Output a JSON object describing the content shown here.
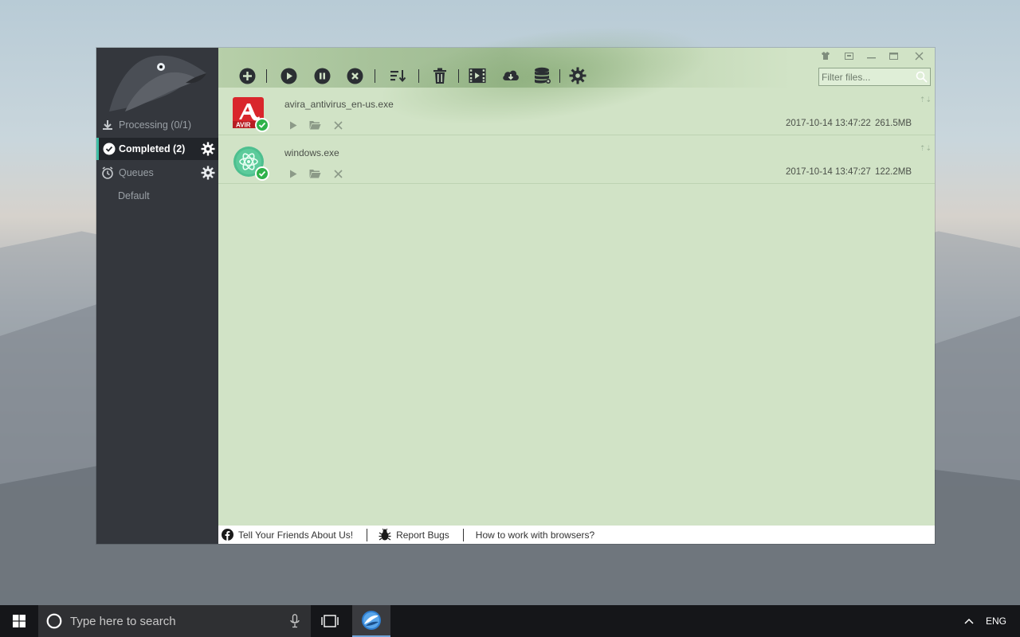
{
  "desktop": {
    "wallpaper": "mountain-mist"
  },
  "window": {
    "controls": [
      "skin-icon",
      "mini-mode-icon",
      "minimize-icon",
      "maximize-icon",
      "close-icon"
    ]
  },
  "sidebar": {
    "processing": "Processing (0/1)",
    "completed": "Completed (2)",
    "queues": "Queues",
    "default_queue": "Default"
  },
  "toolbar": {
    "buttons": [
      "add-icon",
      "start-icon",
      "pause-icon",
      "stop-icon",
      "sort-icon",
      "delete-icon",
      "video-icon",
      "cloud-download-icon",
      "database-icon",
      "settings-icon"
    ],
    "filter_placeholder": "Filter files..."
  },
  "downloads": [
    {
      "name": "avira_antivirus_en-us.exe",
      "date": "2017-10-14 13:47:22",
      "size": "261.5MB",
      "icon": "avira-icon",
      "status": "completed"
    },
    {
      "name": "windows.exe",
      "date": "2017-10-14 13:47:27",
      "size": "122.2MB",
      "icon": "atom-icon",
      "status": "completed"
    }
  ],
  "footer": {
    "tell_friends": "Tell Your Friends About Us!",
    "report_bugs": "Report Bugs",
    "how_to": "How to work with browsers?"
  },
  "taskbar": {
    "search_placeholder": "Type here to search",
    "language": "ENG"
  },
  "colors": {
    "accent": "#3fbfa6",
    "main_bg": "#d1e3c6",
    "sidebar_bg": "#34373d",
    "badge_green": "#2fb24a"
  }
}
